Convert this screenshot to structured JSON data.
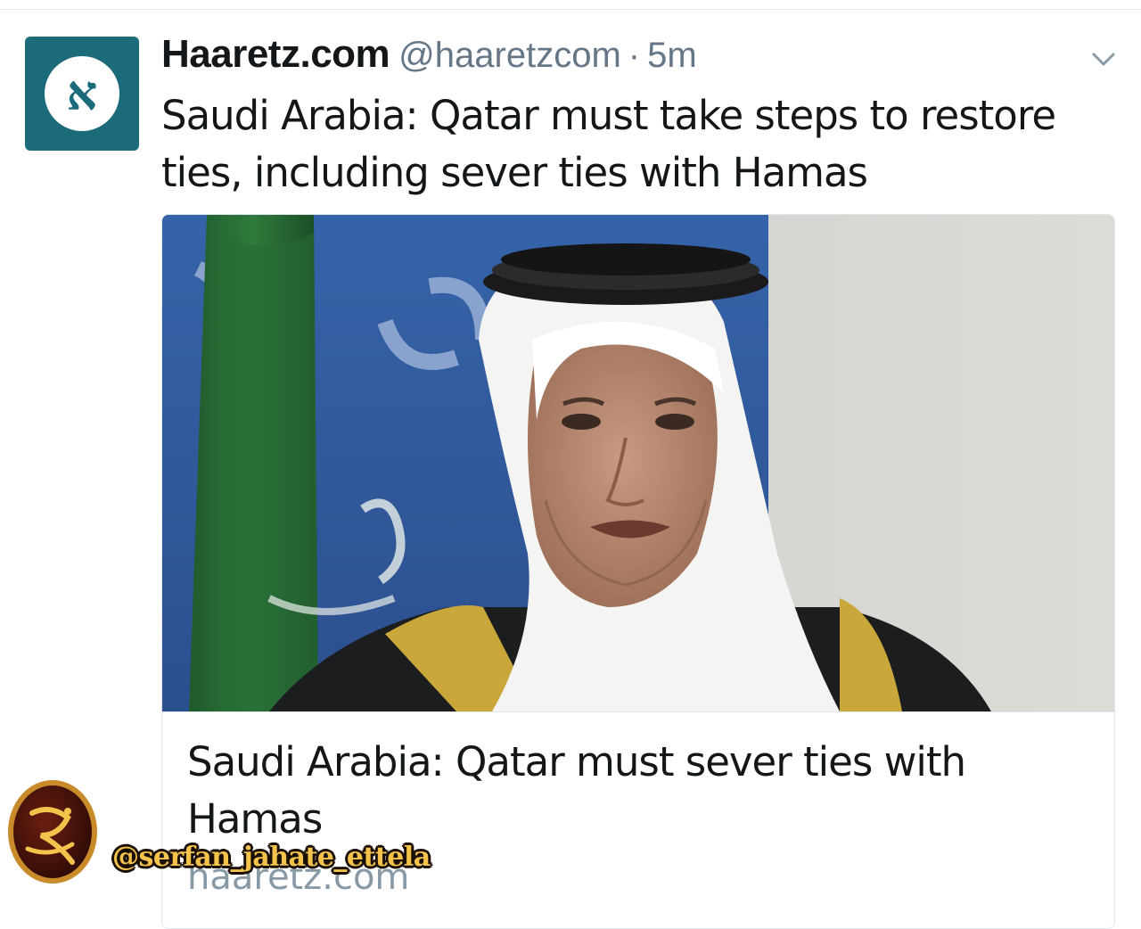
{
  "tweet": {
    "author_name": "Haaretz.com",
    "author_handle": "@haaretzcom",
    "separator": "·",
    "timestamp": "5m",
    "avatar_icon": "haaretz-aleph-logo",
    "avatar_glyph": "א",
    "text": "Saudi Arabia: Qatar must take steps to restore ties, including sever ties with Hamas",
    "menu_icon": "chevron-down-icon"
  },
  "card": {
    "image_alt": "Saudi official speaking in front of Saudi flag",
    "title": "Saudi Arabia: Qatar must sever ties with Hamas",
    "domain": "haaretz.com"
  },
  "watermark": {
    "handle": "@serfan_jahate_ettela"
  },
  "colors": {
    "avatar_bg": "#1b6b7a",
    "text_primary": "#14171a",
    "text_secondary": "#657786",
    "border": "#e1e8ed",
    "watermark_gold": "#f3c34c"
  }
}
